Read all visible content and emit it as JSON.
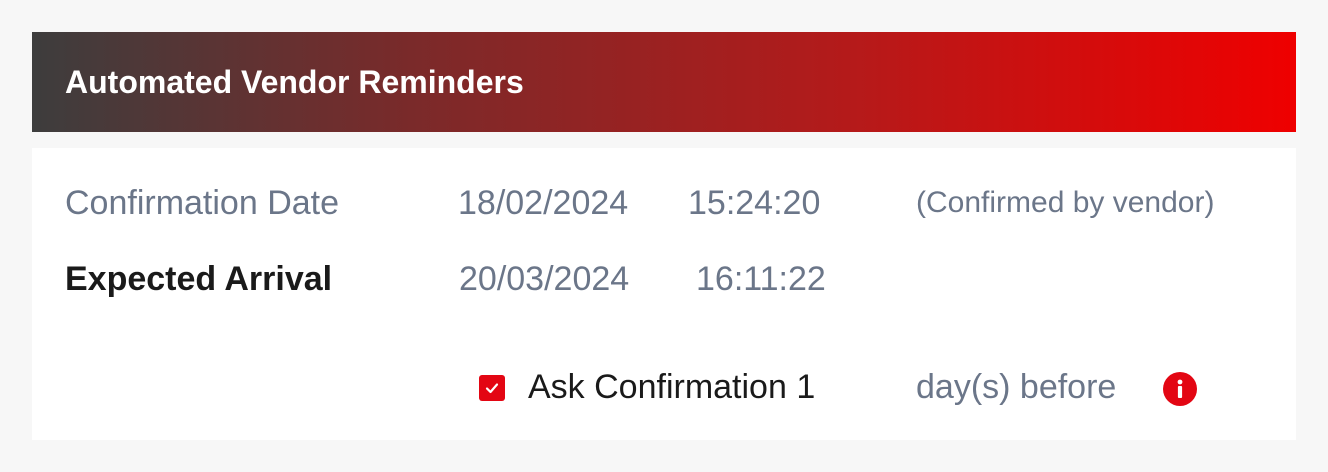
{
  "header": {
    "title": "Automated Vendor Reminders"
  },
  "confirmation": {
    "label": "Confirmation Date",
    "date": "18/02/2024",
    "time": "15:24:20",
    "note": "(Confirmed by vendor)"
  },
  "expected": {
    "label": "Expected Arrival",
    "date": "20/03/2024",
    "time": "16:11:22"
  },
  "reminder": {
    "checked": true,
    "label": "Ask Confirmation",
    "days_value": "1",
    "unit_label": "day(s) before"
  },
  "icons": {
    "checkbox": "checkmark-icon",
    "info": "info-icon"
  },
  "colors": {
    "accent": "#e30613",
    "header_gradient_start": "#3d3d3d",
    "header_gradient_end": "#ef0000",
    "muted_text": "#6b7689"
  }
}
